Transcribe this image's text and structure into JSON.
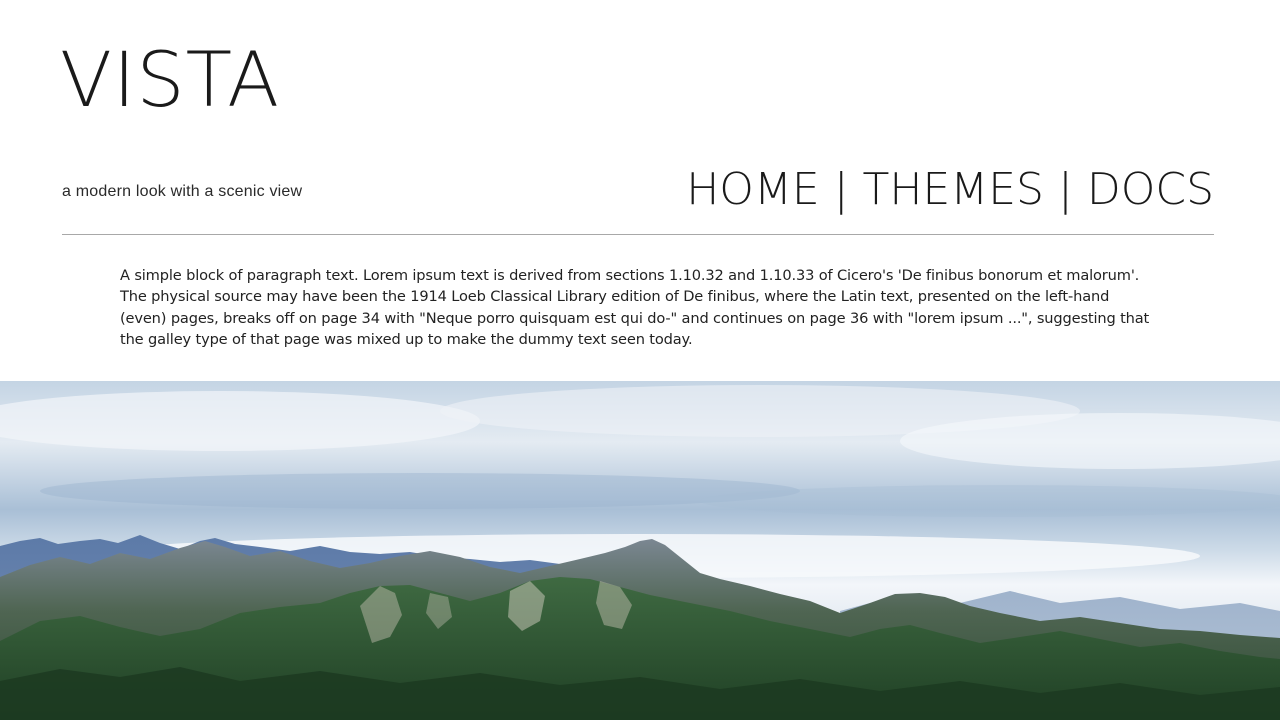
{
  "header": {
    "logo": "VISTA",
    "tagline": "a modern look with a scenic view"
  },
  "nav": {
    "items": [
      {
        "label": "HOME"
      },
      {
        "label": "THEMES"
      },
      {
        "label": "DOCS"
      }
    ],
    "separator": "|"
  },
  "content": {
    "paragraph": "A simple block of paragraph text. Lorem ipsum text is derived from sections 1.10.32 and 1.10.33 of Cicero's 'De finibus bonorum et malorum'. The physical source may have been the 1914 Loeb Classical Library edition of De finibus, where the Latin text, presented on the left-hand (even) pages, breaks off on page 34 with \"Neque porro quisquam est qui do-\" and continues on page 36 with \"lorem ipsum ...\", suggesting that the galley type of that page was mixed up to make the dummy text seen today."
  },
  "hero": {
    "subject": "mountain-landscape-image"
  },
  "colors": {
    "background": "#ffffff",
    "text": "#1a1a1a",
    "divider": "#a8a8a8",
    "sky": "#c9d8e7",
    "mountain": "#2f5a3a"
  }
}
